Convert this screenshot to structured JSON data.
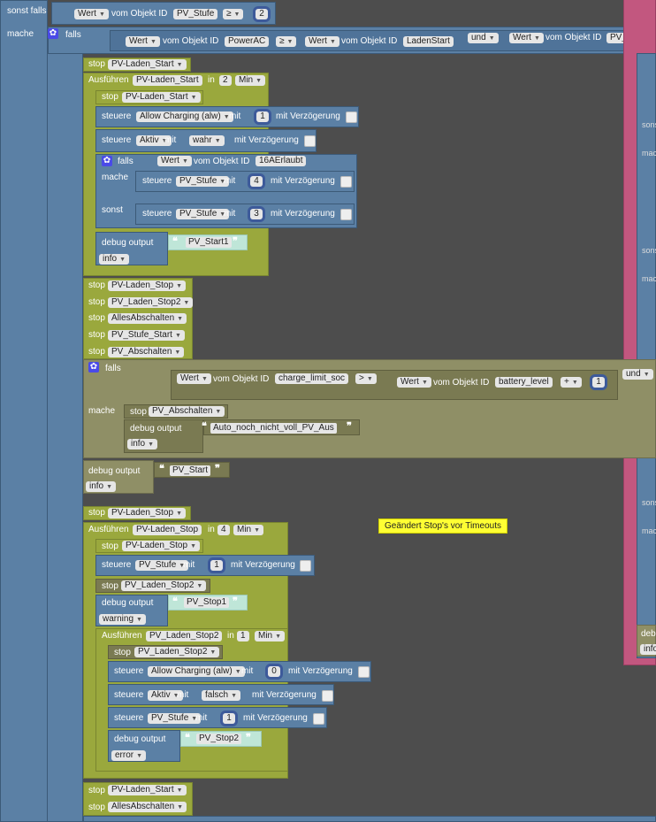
{
  "kw": {
    "else_if": "sonst falls",
    "do": "mache",
    "if": "falls",
    "else": "sonst",
    "stop": "stop",
    "execute": "Ausführen",
    "in": "in",
    "set": "steuere",
    "with": "mit",
    "with_delay": "mit Verzögerung",
    "debug_output": "debug output",
    "value": "Wert",
    "from_object": "vom Objekt ID",
    "and": "und",
    "min": "Min"
  },
  "top_condition": {
    "object": "PV_Stufe",
    "op": "≥",
    "number": "2"
  },
  "main_if": {
    "object1": "PowerAC",
    "op": "≥",
    "object2": "LadenStart",
    "object3": "PV_Aus"
  },
  "do_block": {
    "stop1": "PV-Laden_Start",
    "timeout1": {
      "name": "PV-Laden_Start",
      "value": "2"
    },
    "inner_stop": "PV-Laden_Start",
    "set1": {
      "target": "Allow Charging (alw)",
      "value": "1"
    },
    "set2": {
      "target": "Aktiv",
      "value": "wahr"
    },
    "inner_if_object": "16AErlaubt",
    "set3": {
      "target": "PV_Stufe",
      "value": "4"
    },
    "set4": {
      "target": "PV_Stufe",
      "value": "3"
    },
    "debug1_text": "PV_Start1",
    "debug1_level": "info",
    "stops": [
      "PV-Laden_Stop",
      "PV_Laden_Stop2",
      "AllesAbschalten",
      "PV_Stufe_Start",
      "PV_Abschalten"
    ],
    "cond2": {
      "object1": "charge_limit_soc",
      "op": ">",
      "object2": "battery_level",
      "plus": "+",
      "number": "1"
    },
    "stop_in_cond2": "PV_Abschalten",
    "debug2_text": "Auto_noch_nicht_voll_PV_Aus",
    "debug2_level": "info",
    "debug3_text": "PV_Start",
    "debug3_level": "info"
  },
  "else_block": {
    "stop1": "PV-Laden_Stop",
    "timeout1": {
      "name": "PV-Laden_Stop",
      "value": "4"
    },
    "inner_stop": "PV-Laden_Stop",
    "set1": {
      "target": "PV_Stufe",
      "value": "1"
    },
    "stop2": "PV_Laden_Stop2",
    "debug1_text": "PV_Stop1",
    "debug1_level": "warning",
    "timeout2": {
      "name": "PV_Laden_Stop2",
      "value": "1"
    },
    "inner_stop2": "PV_Laden_Stop2",
    "set2": {
      "target": "Allow Charging (alw)",
      "value": "0"
    },
    "set3": {
      "target": "Aktiv",
      "value": "falsch"
    },
    "set4": {
      "target": "PV_Stufe",
      "value": "1"
    },
    "debug2_text": "PV_Stop2",
    "debug2_level": "error",
    "tail_stops": [
      "PV-Laden_Start",
      "AllesAbschalten"
    ]
  },
  "comment_note": "Geändert Stop's vor Timeouts",
  "right_partial": {
    "labels": [
      "sons",
      "mac",
      "sons",
      "mac",
      "mac",
      "sons",
      "mac"
    ],
    "debug_partial": "debu",
    "info_partial": "info"
  }
}
